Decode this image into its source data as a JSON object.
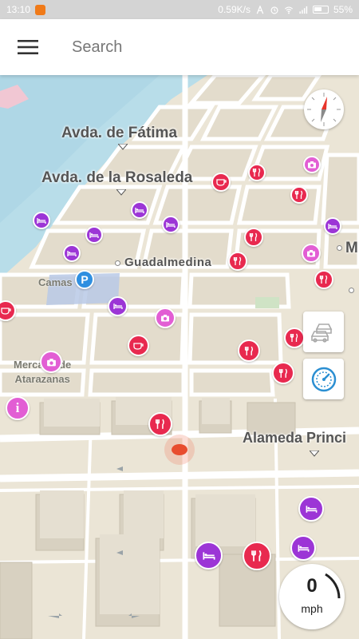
{
  "status_bar": {
    "time": "13:10",
    "network_speed": "0.59K/s",
    "battery": "55%"
  },
  "search": {
    "placeholder": "Search"
  },
  "map": {
    "street_labels": {
      "avda_fatima": "Avda. de Fátima",
      "avda_rosaleda": "Avda. de la Rosaleda",
      "guadalmedina": "Guadalmedina",
      "camas": "Camas",
      "mercado": "Mercado de\nAtarazanas",
      "alameda": "Alameda Princi",
      "m_label": "M"
    },
    "parking_letter": "P",
    "info_letter": "i"
  },
  "speedometer": {
    "value": "0",
    "unit": "mph"
  },
  "colors": {
    "food_poi": "#e8294f",
    "hotel_poi": "#9c35d6",
    "photo_poi": "#e25ed4",
    "water": "#a9d7e8",
    "buildings": "#d9d3c4"
  },
  "icons": {
    "menu": "hamburger-icon",
    "compass": "compass-icon",
    "traffic": "car-traffic-icon",
    "speed": "speedometer-icon"
  }
}
